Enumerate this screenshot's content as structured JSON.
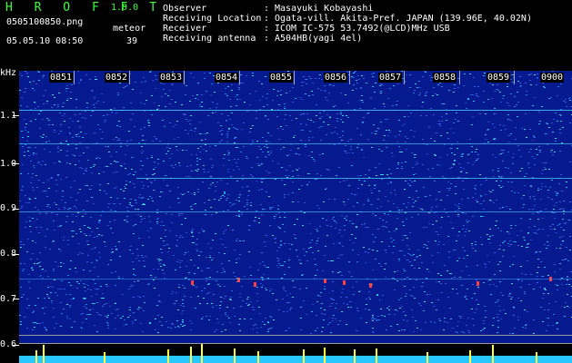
{
  "app": {
    "logo": "H R O F F T",
    "version": "1.0.0"
  },
  "file": {
    "name": "0505100850.png",
    "datetime": "05.05.10 08:50"
  },
  "meteor": {
    "label": "meteor",
    "count": "39"
  },
  "info": [
    {
      "key": "Observer",
      "value": "Masayuki Kobayashi"
    },
    {
      "key": "Receiving Location",
      "value": "Ogata-vill. Akita-Pref. JAPAN (139.96E, 40.02N)"
    },
    {
      "key": "Receiver",
      "value": "ICOM IC-575 53.7492(@LCD)MHz USB"
    },
    {
      "key": "Receiving antenna",
      "value": "A504HB(yagi 4el)"
    }
  ],
  "spectrogram": {
    "y_unit": "kHz",
    "y_ticks": [
      "1.1",
      "1.0",
      "0.9",
      "0.8",
      "0.7",
      "0.6"
    ],
    "time_ticks": [
      "0851",
      "0852",
      "0853",
      "0854",
      "0855",
      "0856",
      "0857",
      "0858",
      "0859",
      "0900"
    ],
    "colors": {
      "background": "#061a8f",
      "trace": "#27e8ff",
      "peak": "#ffff3a",
      "text": "#ffffff"
    }
  }
}
